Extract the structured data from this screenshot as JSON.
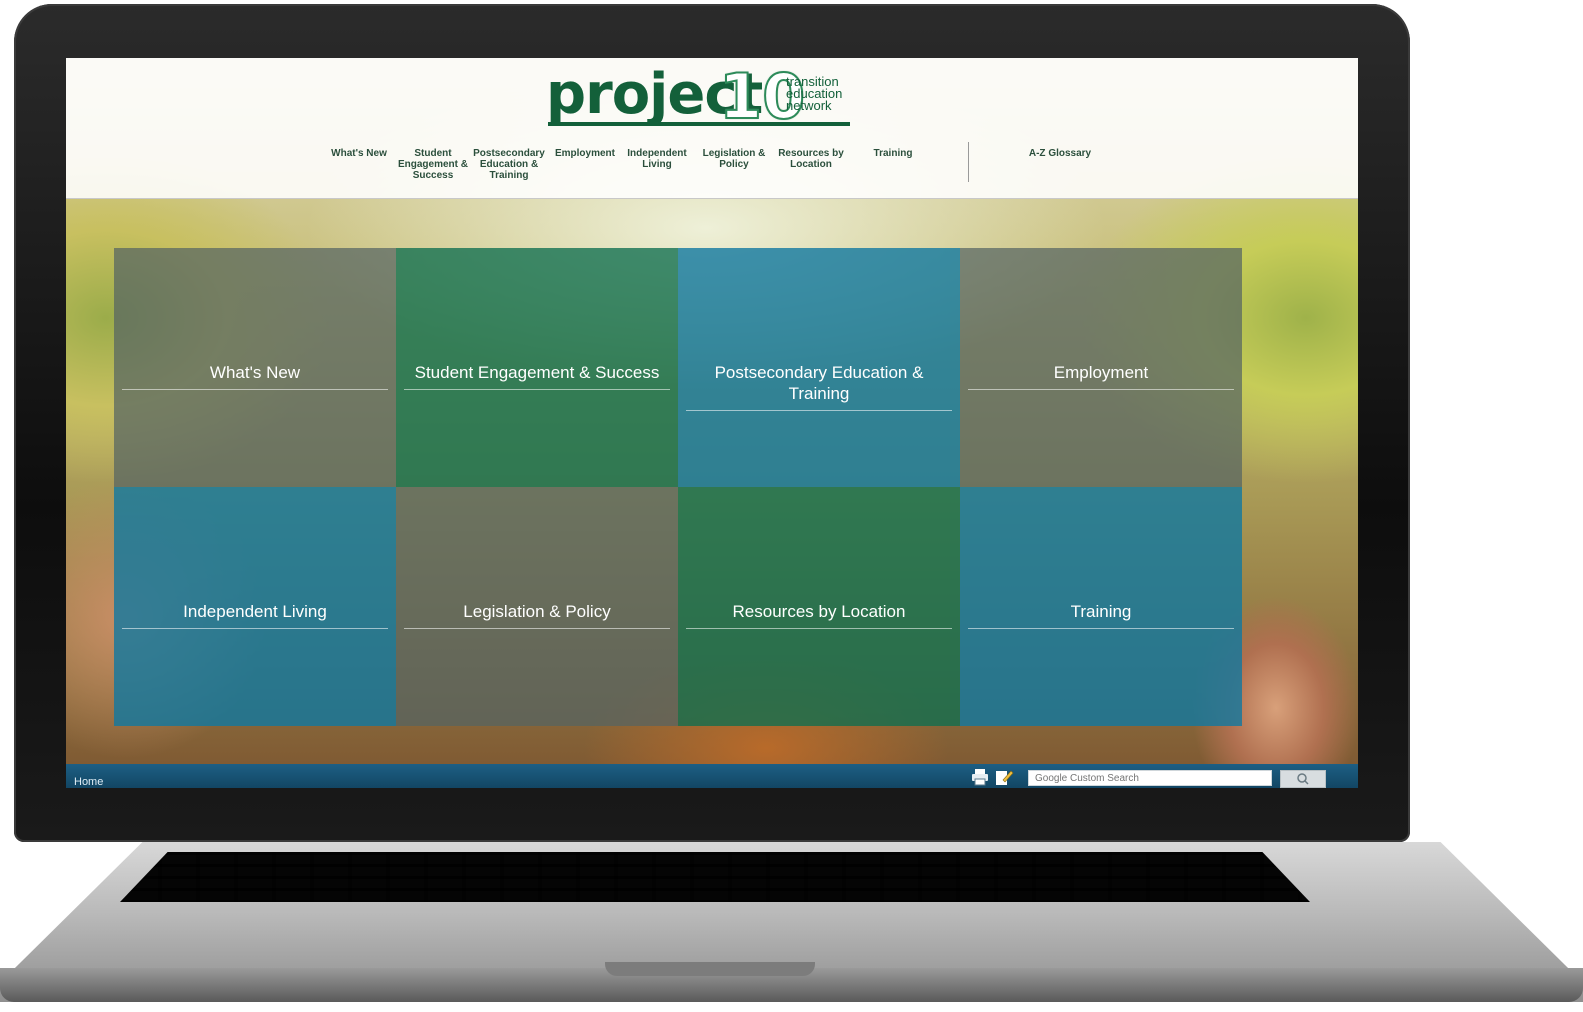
{
  "logo": {
    "word": "project",
    "number": "10",
    "tagline": [
      "transition",
      "education",
      "network"
    ]
  },
  "nav": {
    "items": [
      {
        "label": "What's New"
      },
      {
        "label": "Student Engagement & Success"
      },
      {
        "label": "Postsecondary Education & Training"
      },
      {
        "label": "Employment"
      },
      {
        "label": "Independent Living"
      },
      {
        "label": "Legislation & Policy"
      },
      {
        "label": "Resources by Location"
      },
      {
        "label": "Training"
      }
    ],
    "glossary": "A-Z Glossary"
  },
  "tiles": [
    {
      "label": "What's New",
      "color": "gray"
    },
    {
      "label": "Student Engagement & Success",
      "color": "green"
    },
    {
      "label": "Postsecondary Education & Training",
      "color": "blue"
    },
    {
      "label": "Employment",
      "color": "gray"
    },
    {
      "label": "Independent Living",
      "color": "blue"
    },
    {
      "label": "Legislation & Policy",
      "color": "gray"
    },
    {
      "label": "Resources by Location",
      "color": "green"
    },
    {
      "label": "Training",
      "color": "blue"
    }
  ],
  "footer": {
    "home": "Home",
    "search_placeholder": "Google Custom Search"
  },
  "colors": {
    "brand_green": "#13603a",
    "tile_blue": "#1078a0",
    "tile_green": "#0e6e50",
    "tile_gray": "#546462",
    "footer_blue": "#1d5f84"
  },
  "icons": [
    "print-icon",
    "edit-icon",
    "search-icon"
  ]
}
